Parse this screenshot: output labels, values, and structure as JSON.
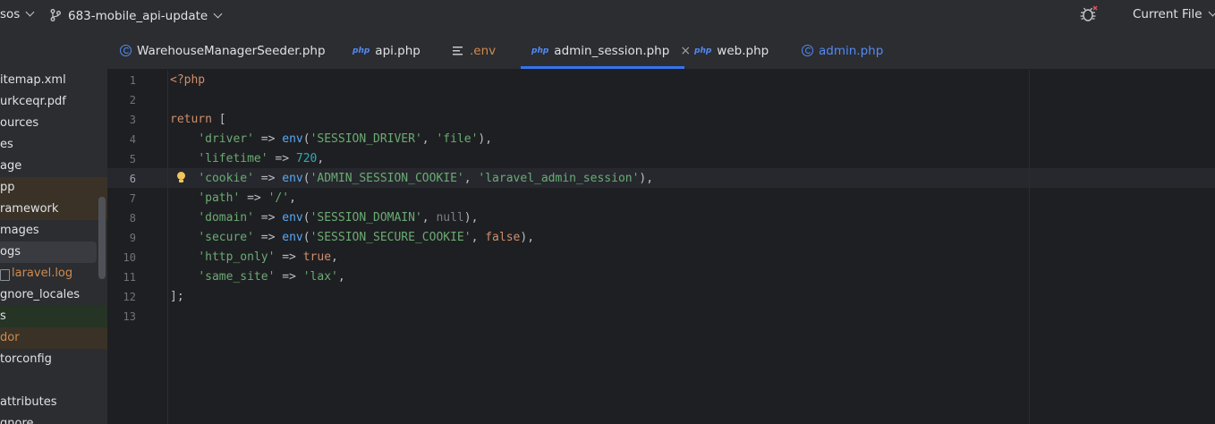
{
  "topbar": {
    "project": "sos",
    "branch": "683-mobile_api-update",
    "run_config": "Current File",
    "debug_icon": "bug-icon"
  },
  "sidebar": {
    "items": [
      {
        "label": "itemap.xml",
        "color": "#dfe1e5",
        "bg": ""
      },
      {
        "label": "urkceqr.pdf",
        "color": "#dfe1e5",
        "bg": ""
      },
      {
        "label": "ources",
        "color": "#dfe1e5",
        "bg": ""
      },
      {
        "label": "es",
        "color": "#dfe1e5",
        "bg": ""
      },
      {
        "label": "age",
        "color": "#dfe1e5",
        "bg": ""
      },
      {
        "label": "pp",
        "color": "#dfe1e5",
        "bg": "#3a3227"
      },
      {
        "label": "ramework",
        "color": "#dfe1e5",
        "bg": "#3a3227"
      },
      {
        "label": "mages",
        "color": "#dfe1e5",
        "bg": ""
      },
      {
        "label": "ogs",
        "color": "#dfe1e5",
        "bg": "#393b40"
      },
      {
        "label": "laravel.log",
        "color": "#d08a4e",
        "bg": "",
        "icon": "log-file-icon"
      },
      {
        "label": "gnore_locales",
        "color": "#dfe1e5",
        "bg": ""
      },
      {
        "label": "s",
        "color": "#dfe1e5",
        "bg": "#253425"
      },
      {
        "label": "dor",
        "color": "#d08a4e",
        "bg": "#3a3227"
      },
      {
        "label": "torconfig",
        "color": "#dfe1e5",
        "bg": ""
      },
      {
        "label": "",
        "color": "#d08a4e",
        "bg": ""
      },
      {
        "label": "attributes",
        "color": "#dfe1e5",
        "bg": ""
      },
      {
        "label": "gnore",
        "color": "#dfe1e5",
        "bg": ""
      }
    ]
  },
  "tabs": [
    {
      "label": "WarehouseManagerSeeder.php",
      "icon": "class-icon",
      "color": "#dfe1e5",
      "active": false
    },
    {
      "label": "api.php",
      "icon": "php-icon",
      "color": "#dfe1e5",
      "active": false
    },
    {
      "label": ".env",
      "icon": "text-file-icon",
      "color": "#d08a4e",
      "active": false
    },
    {
      "label": "admin_session.php",
      "icon": "php-icon",
      "color": "#dfe1e5",
      "active": true
    },
    {
      "label": "web.php",
      "icon": "php-icon",
      "color": "#dfe1e5",
      "active": false
    },
    {
      "label": "admin.php",
      "icon": "class-icon",
      "color": "#548af7",
      "active": false
    }
  ],
  "tab_close": "×",
  "editor": {
    "current_line": 6,
    "lines": [
      {
        "n": "1",
        "tokens": [
          {
            "t": "<?php",
            "c": "kw"
          }
        ]
      },
      {
        "n": "2",
        "tokens": []
      },
      {
        "n": "3",
        "tokens": [
          {
            "t": "return",
            "c": "kw"
          },
          {
            "t": " [",
            "c": ""
          }
        ]
      },
      {
        "n": "4",
        "tokens": [
          {
            "t": "    ",
            "c": ""
          },
          {
            "t": "'driver'",
            "c": "str"
          },
          {
            "t": " => ",
            "c": ""
          },
          {
            "t": "env",
            "c": "fn"
          },
          {
            "t": "(",
            "c": ""
          },
          {
            "t": "'SESSION_DRIVER'",
            "c": "str"
          },
          {
            "t": ", ",
            "c": ""
          },
          {
            "t": "'file'",
            "c": "str"
          },
          {
            "t": "),",
            "c": ""
          }
        ]
      },
      {
        "n": "5",
        "tokens": [
          {
            "t": "    ",
            "c": ""
          },
          {
            "t": "'lifetime'",
            "c": "str"
          },
          {
            "t": " => ",
            "c": ""
          },
          {
            "t": "720",
            "c": "num"
          },
          {
            "t": ",",
            "c": ""
          }
        ]
      },
      {
        "n": "6",
        "tokens": [
          {
            "t": "    ",
            "c": ""
          },
          {
            "t": "'cookie'",
            "c": "str"
          },
          {
            "t": " => ",
            "c": ""
          },
          {
            "t": "env",
            "c": "fn"
          },
          {
            "t": "(",
            "c": ""
          },
          {
            "t": "'ADMIN_SESSION_COOKIE'",
            "c": "str"
          },
          {
            "t": ", ",
            "c": ""
          },
          {
            "t": "'laravel_admin_session'",
            "c": "str"
          },
          {
            "t": "),",
            "c": ""
          }
        ]
      },
      {
        "n": "7",
        "tokens": [
          {
            "t": "    ",
            "c": ""
          },
          {
            "t": "'path'",
            "c": "str"
          },
          {
            "t": " => ",
            "c": ""
          },
          {
            "t": "'/'",
            "c": "str"
          },
          {
            "t": ",",
            "c": ""
          }
        ]
      },
      {
        "n": "8",
        "tokens": [
          {
            "t": "    ",
            "c": ""
          },
          {
            "t": "'domain'",
            "c": "str"
          },
          {
            "t": " => ",
            "c": ""
          },
          {
            "t": "env",
            "c": "fn"
          },
          {
            "t": "(",
            "c": ""
          },
          {
            "t": "'SESSION_DOMAIN'",
            "c": "str"
          },
          {
            "t": ", ",
            "c": ""
          },
          {
            "t": "null",
            "c": "nul"
          },
          {
            "t": "),",
            "c": ""
          }
        ]
      },
      {
        "n": "9",
        "tokens": [
          {
            "t": "    ",
            "c": ""
          },
          {
            "t": "'secure'",
            "c": "str"
          },
          {
            "t": " => ",
            "c": ""
          },
          {
            "t": "env",
            "c": "fn"
          },
          {
            "t": "(",
            "c": ""
          },
          {
            "t": "'SESSION_SECURE_COOKIE'",
            "c": "str"
          },
          {
            "t": ", ",
            "c": ""
          },
          {
            "t": "false",
            "c": "kw"
          },
          {
            "t": "),",
            "c": ""
          }
        ]
      },
      {
        "n": "10",
        "tokens": [
          {
            "t": "    ",
            "c": ""
          },
          {
            "t": "'http_only'",
            "c": "str"
          },
          {
            "t": " => ",
            "c": ""
          },
          {
            "t": "true",
            "c": "kw"
          },
          {
            "t": ",",
            "c": ""
          }
        ]
      },
      {
        "n": "11",
        "tokens": [
          {
            "t": "    ",
            "c": ""
          },
          {
            "t": "'same_site'",
            "c": "str"
          },
          {
            "t": " => ",
            "c": ""
          },
          {
            "t": "'lax'",
            "c": "str"
          },
          {
            "t": ",",
            "c": ""
          }
        ]
      },
      {
        "n": "12",
        "tokens": [
          {
            "t": "];",
            "c": ""
          }
        ]
      },
      {
        "n": "13",
        "tokens": []
      }
    ]
  },
  "intention_icon": "lightbulb-icon"
}
